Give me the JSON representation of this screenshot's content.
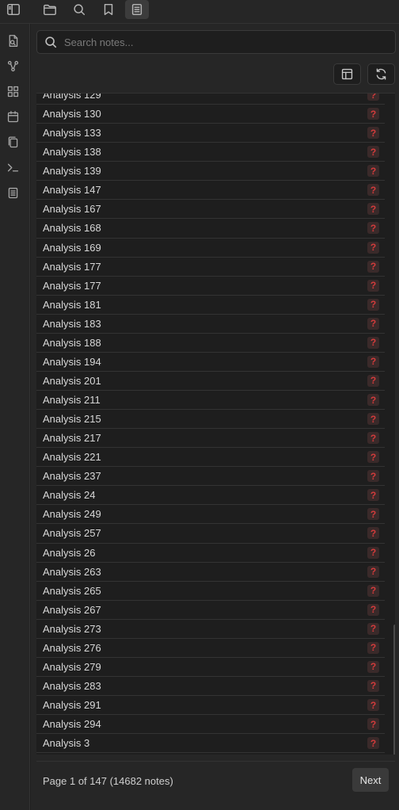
{
  "topbar": {
    "icons": [
      "sidebar-toggle-icon",
      "folder-icon",
      "search-icon",
      "bookmark-icon",
      "notes-list-icon"
    ]
  },
  "ribbon": {
    "icons": [
      "new-note-icon",
      "graph-icon",
      "canvas-icon",
      "calendar-icon",
      "copy-icon",
      "terminal-icon",
      "notes-icon"
    ]
  },
  "search": {
    "placeholder": "Search notes..."
  },
  "toolbar": {
    "layout_icon": "layout-icon",
    "refresh_icon": "refresh-icon"
  },
  "notes": [
    {
      "label": "Analysis 129"
    },
    {
      "label": "Analysis 130"
    },
    {
      "label": "Analysis 133"
    },
    {
      "label": "Analysis 138"
    },
    {
      "label": "Analysis 139"
    },
    {
      "label": "Analysis 147"
    },
    {
      "label": "Analysis 167"
    },
    {
      "label": "Analysis 168"
    },
    {
      "label": "Analysis 169"
    },
    {
      "label": "Analysis 177"
    },
    {
      "label": "Analysis 177"
    },
    {
      "label": "Analysis 181"
    },
    {
      "label": "Analysis 183"
    },
    {
      "label": "Analysis 188"
    },
    {
      "label": "Analysis 194"
    },
    {
      "label": "Analysis 201"
    },
    {
      "label": "Analysis 211"
    },
    {
      "label": "Analysis 215"
    },
    {
      "label": "Analysis 217"
    },
    {
      "label": "Analysis 221"
    },
    {
      "label": "Analysis 237"
    },
    {
      "label": "Analysis 24"
    },
    {
      "label": "Analysis 249"
    },
    {
      "label": "Analysis 257"
    },
    {
      "label": "Analysis 26"
    },
    {
      "label": "Analysis 263"
    },
    {
      "label": "Analysis 265"
    },
    {
      "label": "Analysis 267"
    },
    {
      "label": "Analysis 273"
    },
    {
      "label": "Analysis 276"
    },
    {
      "label": "Analysis 279"
    },
    {
      "label": "Analysis 283"
    },
    {
      "label": "Analysis 291"
    },
    {
      "label": "Analysis 294"
    },
    {
      "label": "Analysis 3"
    }
  ],
  "status_badge": "?",
  "status_color": "#d23b3b",
  "footer": {
    "page_info": "Page 1 of 147 (14682 notes)",
    "next_label": "Next"
  }
}
